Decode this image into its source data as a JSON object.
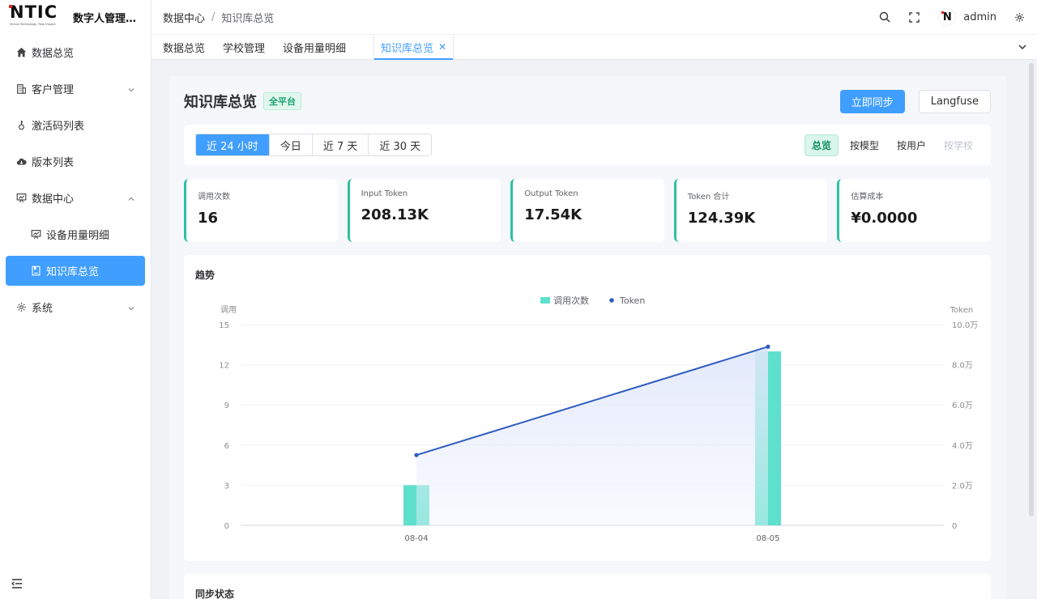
{
  "app": {
    "logo_text": "NTIC",
    "logo_tagline": "Virtual Technology, Real Impact",
    "title": "数字人管理…"
  },
  "sidebar": {
    "items": [
      {
        "label": "数据总览",
        "icon": "home-icon"
      },
      {
        "label": "客户管理",
        "icon": "building-icon",
        "expandable": true
      },
      {
        "label": "激活码列表",
        "icon": "key-icon"
      },
      {
        "label": "版本列表",
        "icon": "cloud-icon"
      },
      {
        "label": "数据中心",
        "icon": "presentation-icon",
        "expanded": true
      },
      {
        "label": "设备用量明细",
        "icon": "presentation-icon",
        "sub": true
      },
      {
        "label": "知识库总览",
        "icon": "book-icon",
        "sub": true,
        "active": true
      },
      {
        "label": "系统",
        "icon": "gear-icon",
        "expandable": true
      }
    ]
  },
  "topbar": {
    "breadcrumb": [
      "数据中心",
      "知识库总览"
    ],
    "username": "admin",
    "avatar_letter": "N"
  },
  "tabs": [
    {
      "label": "数据总览",
      "active": false
    },
    {
      "label": "学校管理",
      "active": false
    },
    {
      "label": "设备用量明细",
      "active": false
    },
    {
      "label": "知识库总览",
      "active": true
    }
  ],
  "page": {
    "title": "知识库总览",
    "platform_tag": "全平台",
    "sync_button": "立即同步",
    "langfuse_button": "Langfuse"
  },
  "filters": {
    "ranges": [
      "近 24 小时",
      "今日",
      "近 7 天",
      "近 30 天"
    ],
    "active_range": 0,
    "views": [
      "总览",
      "按模型",
      "按用户",
      "按学校"
    ],
    "active_view": 0,
    "disabled_view": 3
  },
  "stats": [
    {
      "label": "调用次数",
      "value": "16"
    },
    {
      "label": "Input Token",
      "value": "208.13K"
    },
    {
      "label": "Output Token",
      "value": "17.54K"
    },
    {
      "label": "Token 合计",
      "value": "124.39K"
    },
    {
      "label": "估算成本",
      "value": "¥0.0000"
    }
  ],
  "colors": {
    "accent": "#409eff",
    "bar": "#5ee0cc",
    "line": "#2e5bbf",
    "stat_border": "#2fbfa4"
  },
  "chart_card_title": "趋势",
  "sync_card_title": "同步状态",
  "chart_data": {
    "type": "bar",
    "categories": [
      "08-04",
      "08-05"
    ],
    "series": [
      {
        "name": "调用次数",
        "type": "bar",
        "axis": "left",
        "values": [
          3,
          13
        ]
      },
      {
        "name": "Token",
        "type": "line",
        "axis": "right",
        "values": [
          35000,
          89000
        ]
      }
    ],
    "y_left": {
      "label": "调用",
      "ticks": [
        0,
        3,
        6,
        9,
        12,
        15
      ],
      "ylim": [
        0,
        15
      ]
    },
    "y_right": {
      "label": "Token",
      "ticks": [
        "0",
        "2.0万",
        "4.0万",
        "6.0万",
        "8.0万",
        "10.0万"
      ],
      "ylim": [
        0,
        100000
      ]
    },
    "legend_position": "top-center",
    "grid": true
  }
}
